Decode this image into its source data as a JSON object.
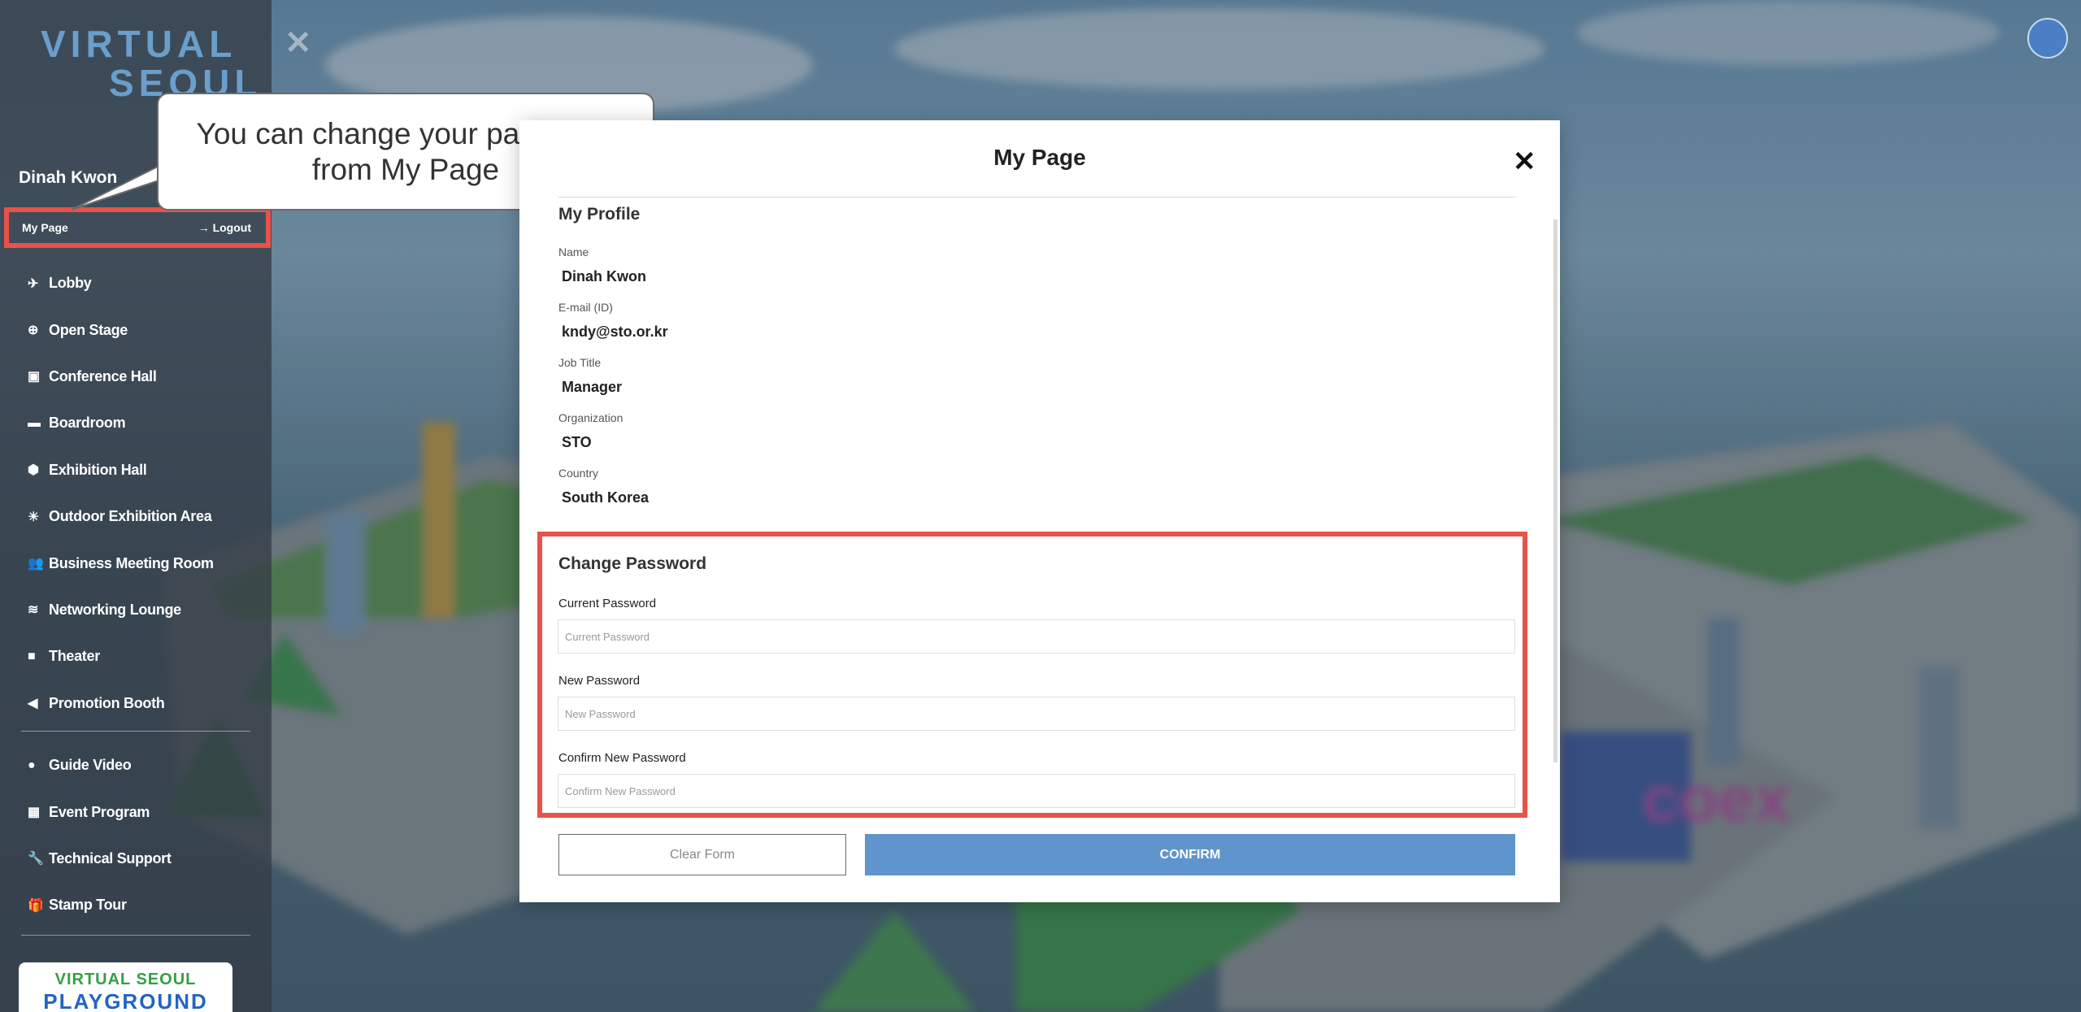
{
  "sidebar": {
    "logo_line1": "VIRTUAL",
    "logo_line2": "SEOUL",
    "user_name": "Dinah Kwon",
    "my_page_link": "My Page",
    "logout_link": "→ Logout",
    "nav_items": [
      {
        "label": "Lobby",
        "icon": "plane-icon"
      },
      {
        "label": "Open Stage",
        "icon": "globe-icon"
      },
      {
        "label": "Conference Hall",
        "icon": "play-icon"
      },
      {
        "label": "Boardroom",
        "icon": "briefcase-icon"
      },
      {
        "label": "Exhibition Hall",
        "icon": "cube-icon"
      },
      {
        "label": "Outdoor Exhibition Area",
        "icon": "sun-icon"
      },
      {
        "label": "Business Meeting Room",
        "icon": "users-icon"
      },
      {
        "label": "Networking Lounge",
        "icon": "wifi-icon"
      },
      {
        "label": "Theater",
        "icon": "video-icon"
      },
      {
        "label": "Promotion Booth",
        "icon": "megaphone-icon"
      }
    ],
    "secondary_items": [
      {
        "label": "Guide Video",
        "icon": "play-circle-icon"
      },
      {
        "label": "Event Program",
        "icon": "calendar-icon"
      },
      {
        "label": "Technical Support",
        "icon": "wrench-icon"
      },
      {
        "label": "Stamp Tour",
        "icon": "gift-icon"
      }
    ],
    "banner_line1": "VIRTUAL SEOUL",
    "banner_line2": "PLAYGROUND"
  },
  "callout": {
    "text_line1": "You can change your password",
    "text_line2": "from My Page"
  },
  "modal": {
    "title": "My Page",
    "close_label": "✕",
    "profile_section_title": "My Profile",
    "profile_fields": [
      {
        "label": "Name",
        "value": "Dinah Kwon"
      },
      {
        "label": "E-mail (ID)",
        "value": "kndy@sto.or.kr"
      },
      {
        "label": "Job Title",
        "value": "Manager"
      },
      {
        "label": "Organization",
        "value": "STO"
      },
      {
        "label": "Country",
        "value": "South Korea"
      }
    ],
    "password_section_title": "Change Password",
    "current_password": {
      "label": "Current Password",
      "placeholder": "Current Password",
      "value": ""
    },
    "new_password": {
      "label": "New Password",
      "placeholder": "New Password",
      "value": ""
    },
    "confirm_password": {
      "label": "Confirm New Password",
      "placeholder": "Confirm New Password",
      "value": ""
    },
    "clear_button": "Clear Form",
    "confirm_button": "CONFIRM"
  },
  "colors": {
    "highlight": "#e8524a",
    "confirm_button": "#5f95cc",
    "sidebar_bg": "#343c46"
  }
}
